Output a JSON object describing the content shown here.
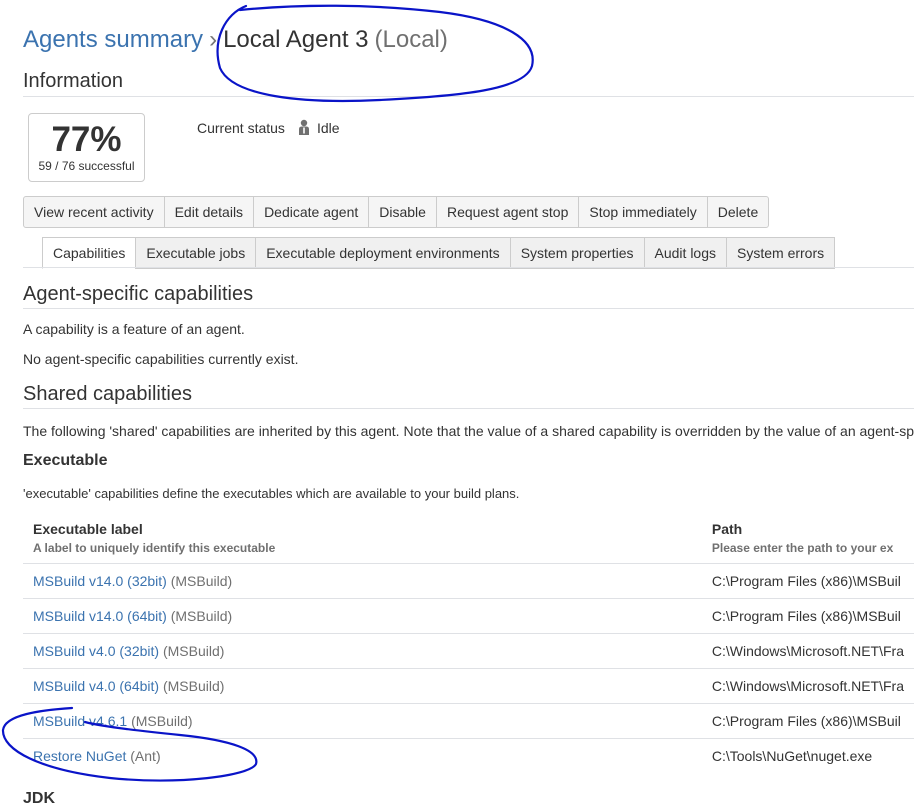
{
  "breadcrumb": {
    "parent": "Agents summary",
    "separator": "›",
    "agent_name": "Local Agent 3",
    "agent_type": "(Local)"
  },
  "information": {
    "heading": "Information",
    "success_rate": "77%",
    "success_detail": "59 / 76 successful",
    "status_label": "Current status",
    "status_value": "Idle"
  },
  "actions": [
    "View recent activity",
    "Edit details",
    "Dedicate agent",
    "Disable",
    "Request agent stop",
    "Stop immediately",
    "Delete"
  ],
  "tabs": [
    "Capabilities",
    "Executable jobs",
    "Executable deployment environments",
    "System properties",
    "Audit logs",
    "System errors"
  ],
  "agent_specific": {
    "heading": "Agent-specific capabilities",
    "line1": "A capability is a feature of an agent.",
    "line2": "No agent-specific capabilities currently exist."
  },
  "shared": {
    "heading": "Shared capabilities",
    "intro": "The following 'shared' capabilities are inherited by this agent. Note that the value of a shared capability is overridden by the value of an agent-sp",
    "executable_heading": "Executable",
    "executable_desc": "'executable' capabilities define the executables which are available to your build plans.",
    "columns": {
      "label": "Executable label",
      "label_desc": "A label to uniquely identify this executable",
      "path": "Path",
      "path_desc": "Please enter the path to your ex"
    },
    "rows": [
      {
        "label": "MSBuild v14.0 (32bit)",
        "kind": "(MSBuild)",
        "path": "C:\\Program Files (x86)\\MSBuil"
      },
      {
        "label": "MSBuild v14.0 (64bit)",
        "kind": "(MSBuild)",
        "path": "C:\\Program Files (x86)\\MSBuil"
      },
      {
        "label": "MSBuild v4.0 (32bit)",
        "kind": "(MSBuild)",
        "path": "C:\\Windows\\Microsoft.NET\\Fra"
      },
      {
        "label": "MSBuild v4.0 (64bit)",
        "kind": "(MSBuild)",
        "path": "C:\\Windows\\Microsoft.NET\\Fra"
      },
      {
        "label": "MSBuild v4.6.1",
        "kind": "(MSBuild)",
        "path": "C:\\Program Files (x86)\\MSBuil"
      },
      {
        "label": "Restore NuGet",
        "kind": "(Ant)",
        "path": "C:\\Tools\\NuGet\\nuget.exe"
      }
    ],
    "jdk_heading": "JDK"
  },
  "icons": {
    "status": "agent-idle-icon"
  },
  "colors": {
    "link": "#3b73af",
    "annotation": "#0a14c8"
  }
}
